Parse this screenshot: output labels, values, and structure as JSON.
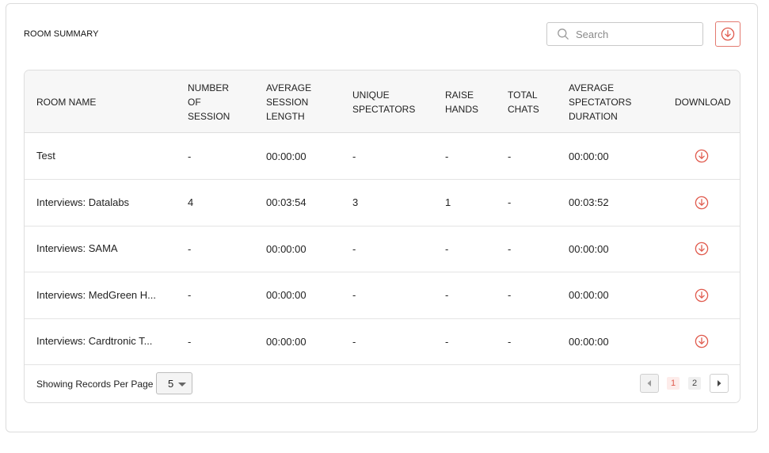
{
  "card": {
    "title": "ROOM SUMMARY",
    "search_placeholder": "Search"
  },
  "table": {
    "headers": [
      "ROOM NAME",
      "NUMBER OF SESSION",
      "AVERAGE SESSION LENGTH",
      "UNIQUE SPECTATORS",
      "RAISE HANDS",
      "TOTAL CHATS",
      "AVERAGE SPECTATORS DURATION",
      "DOWNLOAD"
    ],
    "rows": [
      [
        "Test",
        "-",
        "00:00:00",
        "-",
        "-",
        "-",
        "00:00:00"
      ],
      [
        "Interviews: Datalabs",
        "4",
        "00:03:54",
        "3",
        "1",
        "-",
        "00:03:52"
      ],
      [
        "Interviews: SAMA",
        "-",
        "00:00:00",
        "-",
        "-",
        "-",
        "00:00:00"
      ],
      [
        "Interviews: MedGreen H...",
        "-",
        "00:00:00",
        "-",
        "-",
        "-",
        "00:00:00"
      ],
      [
        "Interviews: Cardtronic T...",
        "-",
        "00:00:00",
        "-",
        "-",
        "-",
        "00:00:00"
      ]
    ]
  },
  "footer": {
    "records_label": "Showing Records Per Page",
    "records_value": "5",
    "pages": [
      "1",
      "2"
    ],
    "current_page": "1"
  },
  "icons": {
    "search": "search-icon",
    "download": "download-circle-icon",
    "prev": "caret-left-icon",
    "next": "caret-right-icon",
    "dropdown": "caret-down-icon"
  },
  "colors": {
    "accent": "#e05a4d",
    "header_bg": "#f7f7f7",
    "border": "#dedede"
  }
}
